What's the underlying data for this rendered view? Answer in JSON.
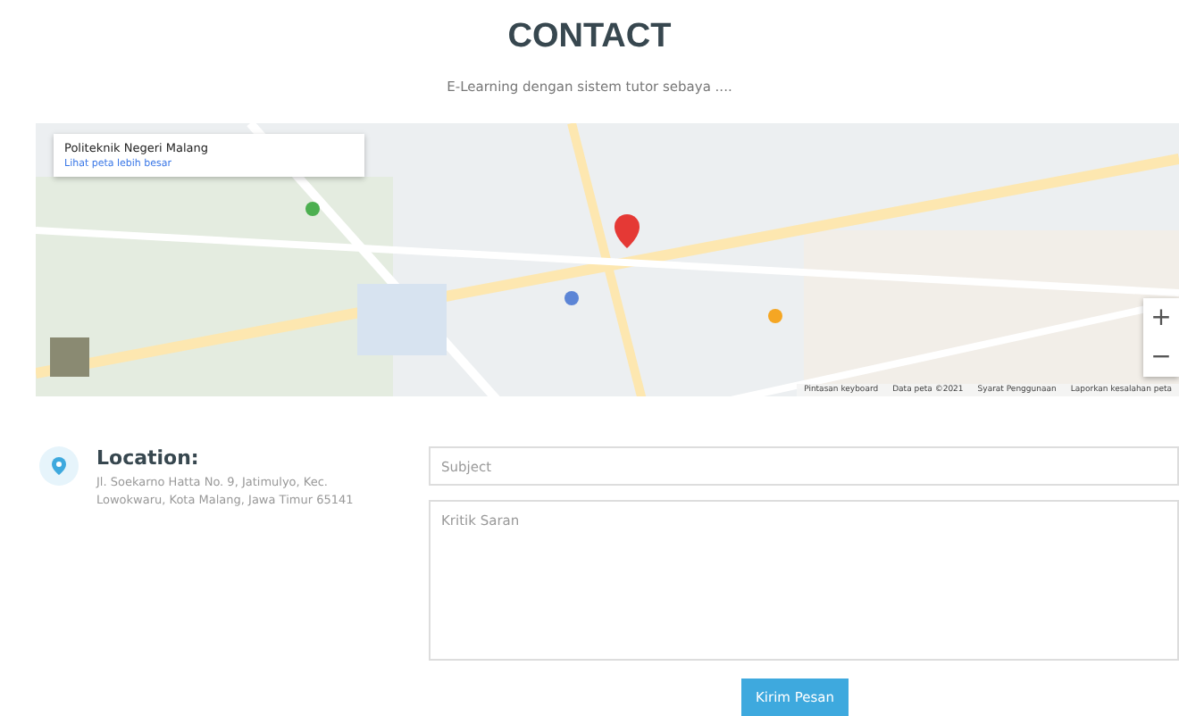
{
  "header": {
    "title": "CONTACT",
    "subtitle": "E-Learning dengan sistem tutor sebaya ...."
  },
  "map": {
    "kind": "picture",
    "place_card": {
      "name": "Politeknik Negeri Malang",
      "link": "Lihat peta lebih besar"
    },
    "zoom_in": "+",
    "zoom_out": "−",
    "footer": [
      "Pintasan keyboard",
      "Data peta ©2021",
      "Syarat Penggunaan",
      "Laporkan kesalahan peta"
    ]
  },
  "location": {
    "label": "Location:",
    "address": "Jl. Soekarno Hatta No. 9, Jatimulyo, Kec. Lowokwaru, Kota Malang, Jawa Timur 65141"
  },
  "form": {
    "subject": {
      "placeholder": "Subject"
    },
    "message": {
      "placeholder": "Kritik Saran"
    },
    "submit": "Kirim Pesan"
  }
}
